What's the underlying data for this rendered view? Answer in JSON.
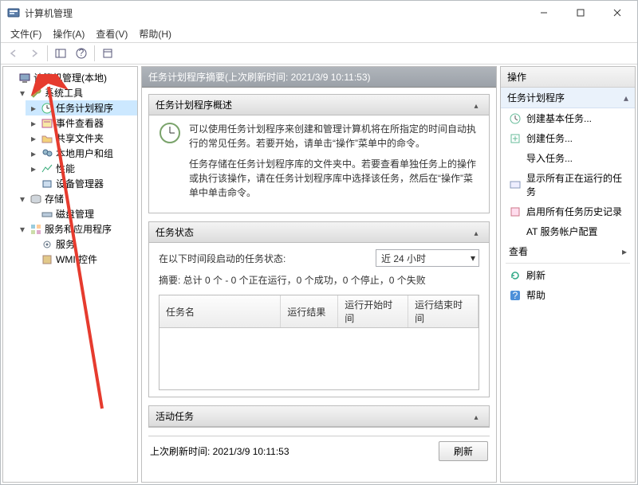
{
  "window": {
    "title": "计算机管理"
  },
  "menu": {
    "file": "文件(F)",
    "action": "操作(A)",
    "view": "查看(V)",
    "help": "帮助(H)"
  },
  "tree": {
    "root": "计算机管理(本地)",
    "sys_tools": "系统工具",
    "task_sched": "任务计划程序",
    "event_viewer": "事件查看器",
    "shared_folders": "共享文件夹",
    "local_users": "本地用户和组",
    "performance": "性能",
    "device_mgr": "设备管理器",
    "storage": "存储",
    "disk_mgmt": "磁盘管理",
    "services_apps": "服务和应用程序",
    "services": "服务",
    "wmi": "WMI 控件"
  },
  "center": {
    "header": "任务计划程序摘要(上次刷新时间: 2021/3/9 10:11:53)",
    "overview_title": "任务计划程序概述",
    "overview_p1": "可以使用任务计划程序来创建和管理计算机将在所指定的时间自动执行的常见任务。若要开始，请单击“操作”菜单中的命令。",
    "overview_p2": "任务存储在任务计划程序库的文件夹中。若要查看单独任务上的操作或执行该操作，请在任务计划程序库中选择该任务，然后在“操作”菜单中单击命令。",
    "status_title": "任务状态",
    "status_label": "在以下时间段启动的任务状态:",
    "status_period": "近 24 小时",
    "status_summary": "摘要: 总计 0 个 - 0 个正在运行，0 个成功，0 个停止，0 个失败",
    "col_name": "任务名",
    "col_result": "运行结果",
    "col_start": "运行开始时间",
    "col_end": "运行结束时间",
    "active_title": "活动任务",
    "last_refresh": "上次刷新时间: 2021/3/9 10:11:53",
    "refresh_btn": "刷新"
  },
  "actions": {
    "header": "操作",
    "category": "任务计划程序",
    "create_basic": "创建基本任务...",
    "create_task": "创建任务...",
    "import_task": "导入任务...",
    "show_running": "显示所有正在运行的任务",
    "enable_history": "启用所有任务历史记录",
    "at_config": "AT 服务帐户配置",
    "view": "查看",
    "refresh": "刷新",
    "help": "帮助"
  }
}
